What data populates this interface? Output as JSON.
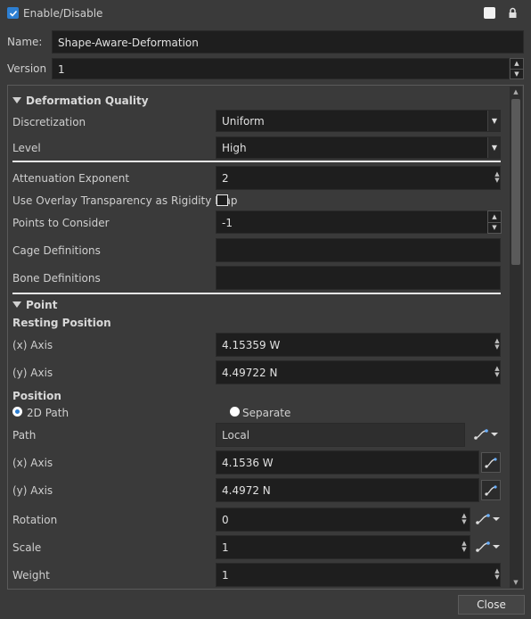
{
  "header": {
    "enable_label": "Enable/Disable",
    "name_label": "Name:",
    "name_value": "Shape-Aware-Deformation",
    "version_label": "Version",
    "version_value": "1"
  },
  "deformation": {
    "section_title": "Deformation Quality",
    "discretization_label": "Discretization",
    "discretization_value": "Uniform",
    "level_label": "Level",
    "level_value": "High",
    "attenuation_label": "Attenuation Exponent",
    "attenuation_value": "2",
    "overlay_label": "Use Overlay Transparency as Rigidity Map",
    "points_label": "Points to Consider",
    "points_value": "-1",
    "cage_label": "Cage Definitions",
    "cage_value": "",
    "bone_label": "Bone Definitions",
    "bone_value": ""
  },
  "point": {
    "section_title": "Point",
    "resting_title": "Resting Position",
    "rest_x_label": "(x) Axis",
    "rest_x_value": "4.15359 W",
    "rest_y_label": "(y) Axis",
    "rest_y_value": "4.49722 N",
    "position_title": "Position",
    "radio_2d": "2D Path",
    "radio_separate": "Separate",
    "path_label": "Path",
    "path_value": "Local",
    "pos_x_label": "(x) Axis",
    "pos_x_value": "4.1536 W",
    "pos_y_label": "(y) Axis",
    "pos_y_value": "4.4972 N",
    "rotation_label": "Rotation",
    "rotation_value": "0",
    "scale_label": "Scale",
    "scale_value": "1",
    "weight_label": "Weight",
    "weight_value": "1"
  },
  "footer": {
    "close_label": "Close"
  }
}
